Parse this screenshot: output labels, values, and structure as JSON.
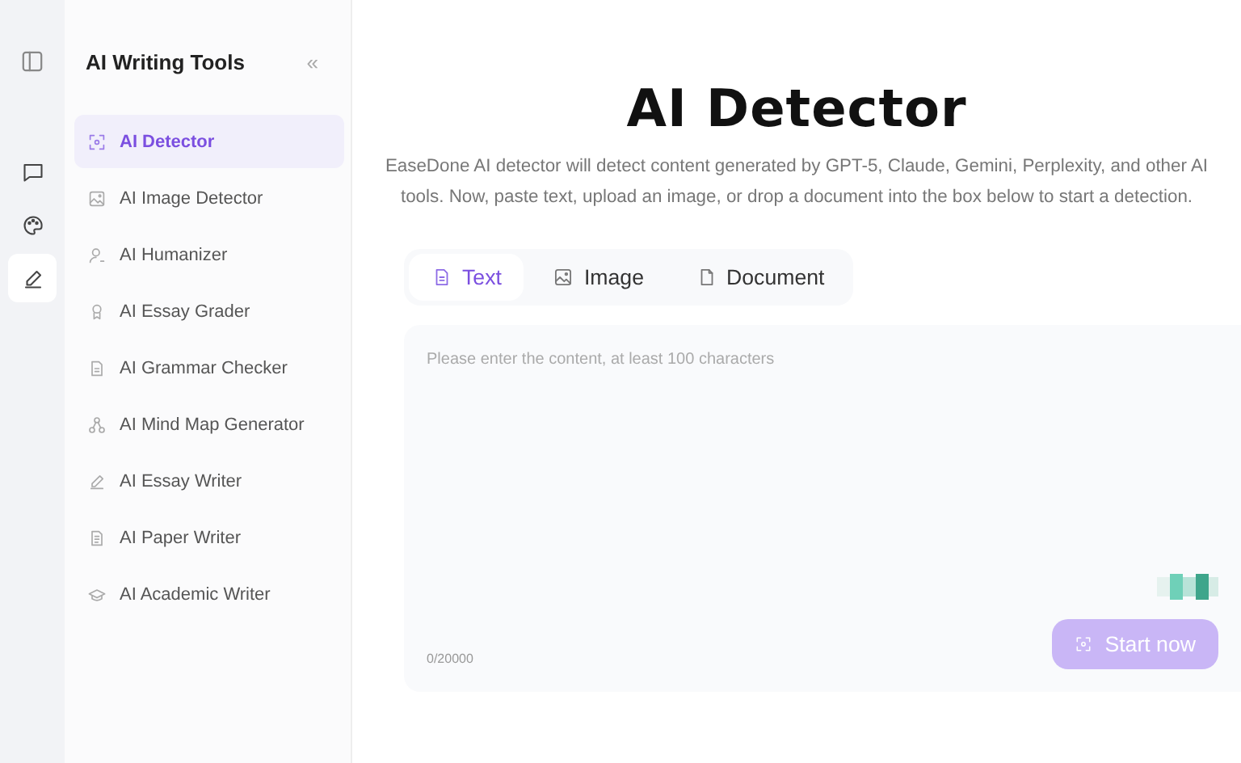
{
  "rail": {
    "items": [
      {
        "kind": "chat",
        "selected": false
      },
      {
        "kind": "palette",
        "selected": false
      },
      {
        "kind": "pen",
        "selected": true
      }
    ]
  },
  "sidebar": {
    "title": "AI Writing Tools",
    "collapse": "«",
    "items": [
      {
        "label": "AI Detector",
        "kind": "scan",
        "selected": true
      },
      {
        "label": "AI Image Detector",
        "kind": "image",
        "selected": false
      },
      {
        "label": "AI Humanizer",
        "kind": "person",
        "selected": false
      },
      {
        "label": "AI Essay Grader",
        "kind": "award",
        "selected": false
      },
      {
        "label": "AI Grammar Checker",
        "kind": "doc",
        "selected": false
      },
      {
        "label": "AI Mind Map Generator",
        "kind": "map",
        "selected": false
      },
      {
        "label": "AI Essay Writer",
        "kind": "pen",
        "selected": false
      },
      {
        "label": "AI Paper Writer",
        "kind": "paper",
        "selected": false
      },
      {
        "label": "AI Academic Writer",
        "kind": "cap",
        "selected": false
      }
    ]
  },
  "main": {
    "title": "AI Detector",
    "description": "EaseDone AI detector will detect content generated by GPT-5, Claude, Gemini, Perplexity, and other AI tools. Now, paste text, upload an image, or drop a document into the box below to start a detection.",
    "tabs": [
      {
        "label": "Text",
        "kind": "text",
        "selected": true
      },
      {
        "label": "Image",
        "kind": "image",
        "selected": false
      },
      {
        "label": "Document",
        "kind": "doc",
        "selected": false
      }
    ],
    "input": {
      "placeholder": "Please enter the content, at least 100 characters",
      "counter": "0/20000"
    },
    "button": {
      "label": "Start now",
      "disabled": true
    }
  }
}
